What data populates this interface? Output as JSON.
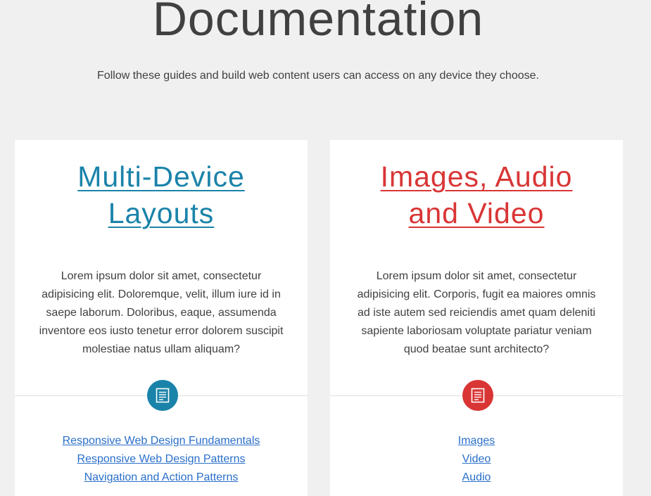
{
  "header": {
    "title": "Documentation",
    "subtitle": "Follow these guides and build web content users can access on any device they choose."
  },
  "cards": [
    {
      "title_line1": "Multi-Device",
      "title_line2": "Layouts",
      "description": "Lorem ipsum dolor sit amet, consectetur adipisicing elit. Doloremque, velit, illum iure id in saepe laborum. Doloribus, eaque, assumenda inventore eos iusto tenetur error dolorem suscipit molestiae natus ullam aliquam?",
      "icon": "document-icon",
      "accent_color": "#1a83a9",
      "links": [
        "Responsive Web Design Fundamentals",
        "Responsive Web Design Patterns",
        "Navigation and Action Patterns"
      ]
    },
    {
      "title_line1": "Images, Audio",
      "title_line2": "and Video",
      "description": "Lorem ipsum dolor sit amet, consectetur adipisicing elit. Corporis, fugit ea maiores omnis ad iste autem sed reiciendis amet quam deleniti sapiente laboriosam voluptate pariatur veniam quod beatae sunt architecto?",
      "icon": "document-icon",
      "accent_color": "#d93535",
      "links": [
        "Images",
        "Video",
        "Audio"
      ]
    }
  ],
  "colors": {
    "background": "#f0f0f0",
    "card": "#ffffff",
    "link": "#2a6fc9",
    "text": "#404040"
  }
}
